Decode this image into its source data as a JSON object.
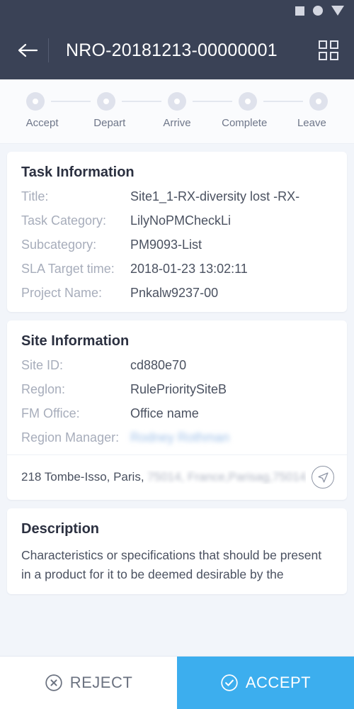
{
  "statusbar": {
    "icons": [
      "square-icon",
      "circle-icon",
      "triangle-down-icon"
    ]
  },
  "appbar": {
    "back_icon": "back-arrow-icon",
    "title": "NRO-20181213-00000001",
    "grid_icon": "grid-menu-icon"
  },
  "stepper": {
    "steps": [
      {
        "label": "Accept"
      },
      {
        "label": "Depart"
      },
      {
        "label": "Arrive"
      },
      {
        "label": "Complete"
      },
      {
        "label": "Leave"
      }
    ]
  },
  "task_information": {
    "title": "Task Information",
    "fields": [
      {
        "label": "Title:",
        "value": "Site1_1-RX-diversity lost -RX-"
      },
      {
        "label": "Task Category:",
        "value": "LilyNoPMCheckLi"
      },
      {
        "label": "Subcategory:",
        "value": "PM9093-List"
      },
      {
        "label": "SLA Target time:",
        "value": "2018-01-23 13:02:11"
      },
      {
        "label": "Project Name:",
        "value": "Pnkalw9237-00"
      }
    ]
  },
  "site_information": {
    "title": "Site Information",
    "fields": [
      {
        "label": "Site ID:",
        "value": "cd880e70"
      },
      {
        "label": "Reglon:",
        "value": "RulePrioritySiteB"
      },
      {
        "label": "FM Office:",
        "value": "Office name"
      },
      {
        "label": "Region Manager:",
        "value": "Rodney Rothman"
      }
    ],
    "address": {
      "visible": "218 Tombe-Isso, Paris,",
      "redacted": "75014, France,Parisag,75014...",
      "nav_icon": "navigate-arrow-icon"
    }
  },
  "description": {
    "title": "Description",
    "text": "Characteristics or specifications that should be present in a product for it to be deemed desirable by the"
  },
  "actionbar": {
    "reject_label": "REJECT",
    "reject_icon": "circle-x-icon",
    "accept_label": "ACCEPT",
    "accept_icon": "circle-check-icon",
    "accept_color": "#3CAEEE"
  }
}
